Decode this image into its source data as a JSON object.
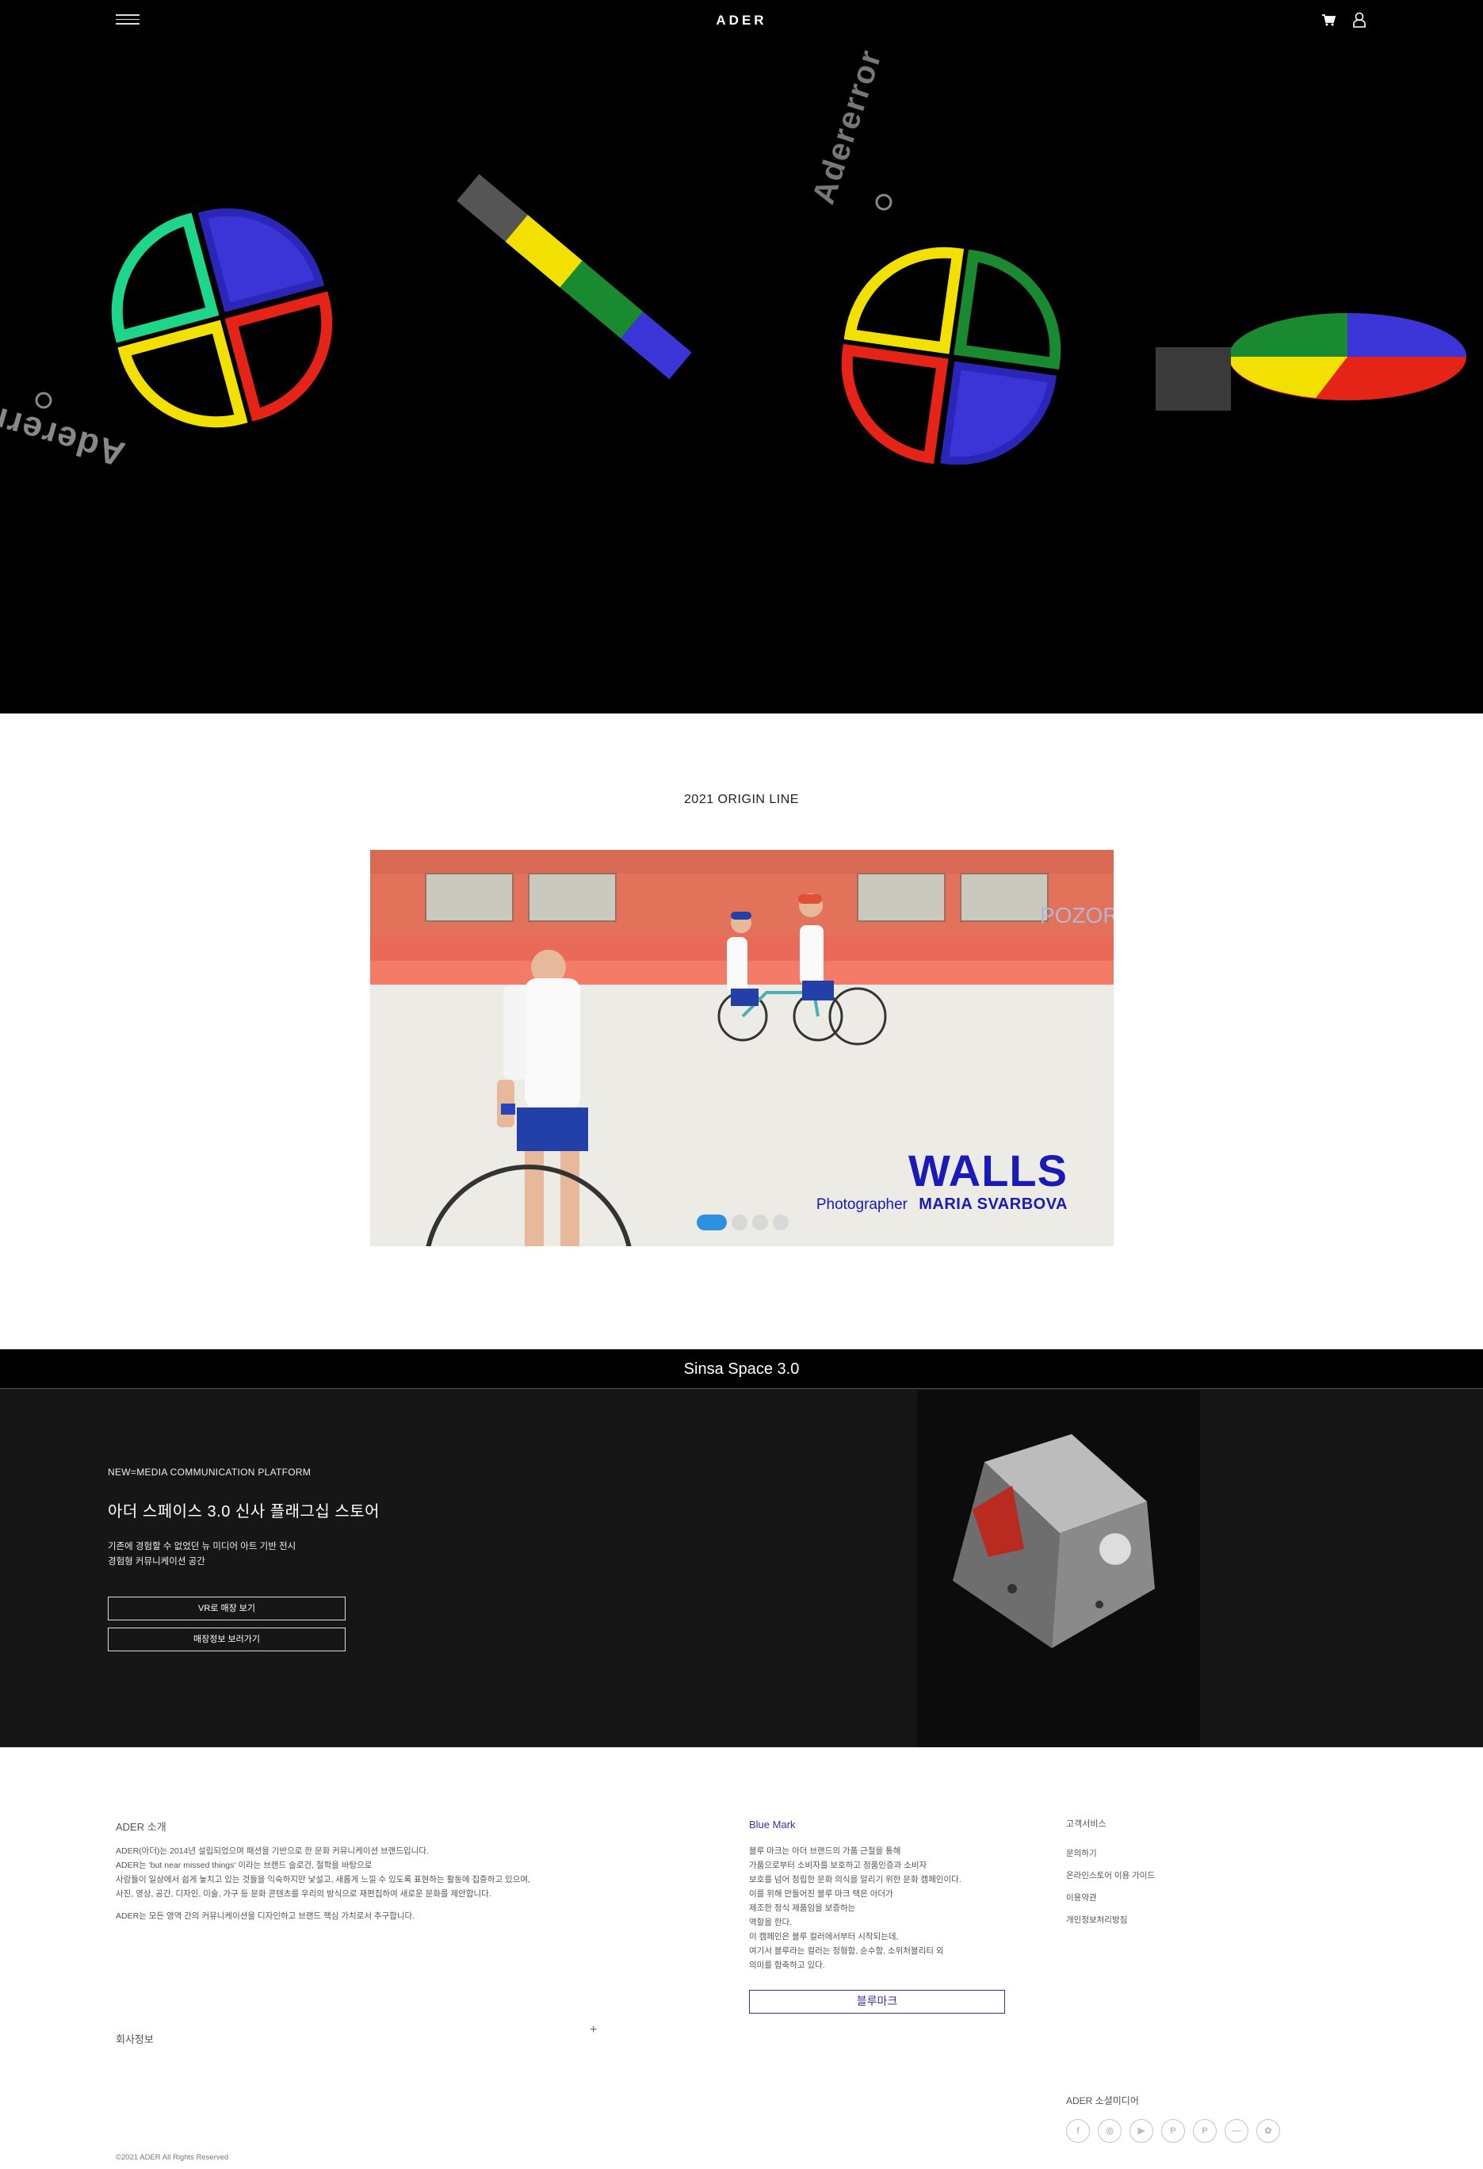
{
  "header": {
    "logo": "ADER",
    "menu_icon": "hamburger-menu-icon",
    "cart_icon": "cart-icon",
    "user_icon": "user-icon"
  },
  "hero": {
    "art_text": "Adererror",
    "colors": {
      "green": "#1ed68a",
      "blue": "#3b35d8",
      "yellow": "#f2e100",
      "red": "#e52317"
    }
  },
  "origin": {
    "title": "2021 ORIGIN LINE",
    "slide": {
      "headline": "WALLS",
      "credit_label": "Photographer",
      "credit_name": "MARIA SVARBOVA",
      "wall_text": "POZOR"
    },
    "slide_count": 4,
    "active_slide": 1
  },
  "space": {
    "bar_title": "Sinsa Space 3.0",
    "kicker": "NEW=MEDIA COMMUNICATION PLATFORM",
    "title": "아더 스페이스 3.0 신사 플래그십 스토어",
    "desc_line1": "기존에 경험할 수 없었던 뉴 미디어 아트 기반 전시",
    "desc_line2": "경험형 커뮤니케이션 공간",
    "btn_vr": "VR로 매장 보기",
    "btn_info": "매장정보 보러가기"
  },
  "footer": {
    "about_title": "ADER 소개",
    "about_lines": [
      "ADER(아더)는 2014년 설립되었으며 패션을 기반으로 한 문화 커뮤니케이션 브랜드입니다.",
      "ADER는 'but near missed things' 이라는 브랜드 슬로건, 철학을 바탕으로",
      "사람들이 일상에서 쉽게 놓치고 있는 것들을 익숙하지만 낯설고, 새롭게 느낄 수 있도록 표현하는 활동에 집중하고 있으며,",
      "사진, 영상, 공간, 디자인, 미술, 가구 등 문화 콘텐츠를 우리의 방식으로 재편집하여 새로운 문화를 제안합니다.",
      "ADER는 모든 영역 간의 커뮤니케이션을 디자인하고 브랜드 핵심 가치로서 추구합니다."
    ],
    "company_info": "회사정보",
    "plus": "+",
    "blue_title": "Blue Mark",
    "blue_lines": [
      "블루 마크는 아더 브랜드의 가품 근절을 통해",
      "가품으로부터 소비자를 보호하고 정품인증과 소비자",
      "보호를 넘어 정립한 문화 의식을 알리기 위한 문화 캠페인이다.",
      "이를 위해 만들어진 블루 마크 택은 아더가",
      "제조한 정식 제품임을 보증하는",
      "역할을 한다.",
      "이 캠페인은 블루 컬러에서부터 시작되는데,",
      "여기서 블루라는 컬러는 정형함, 순수함, 소위처블리티 외",
      "의미를 함축하고 있다."
    ],
    "blue_button": "블루마크",
    "service_title": "고객서비스",
    "service_links": [
      "문의하기",
      "온라인스토어 이용 가이드",
      "이용약관",
      "개인정보처리방침"
    ],
    "social_title": "ADER 소셜미디어",
    "social_icons": [
      "facebook-icon",
      "instagram-icon",
      "youtube-icon",
      "weibo-icon",
      "pinterest-icon",
      "naver-icon",
      "wechat-icon"
    ],
    "social_glyphs": [
      "f",
      "◎",
      "▶",
      "P",
      "P",
      "—",
      "✿"
    ],
    "copyright": "©2021 ADER All Rights Reserved"
  }
}
